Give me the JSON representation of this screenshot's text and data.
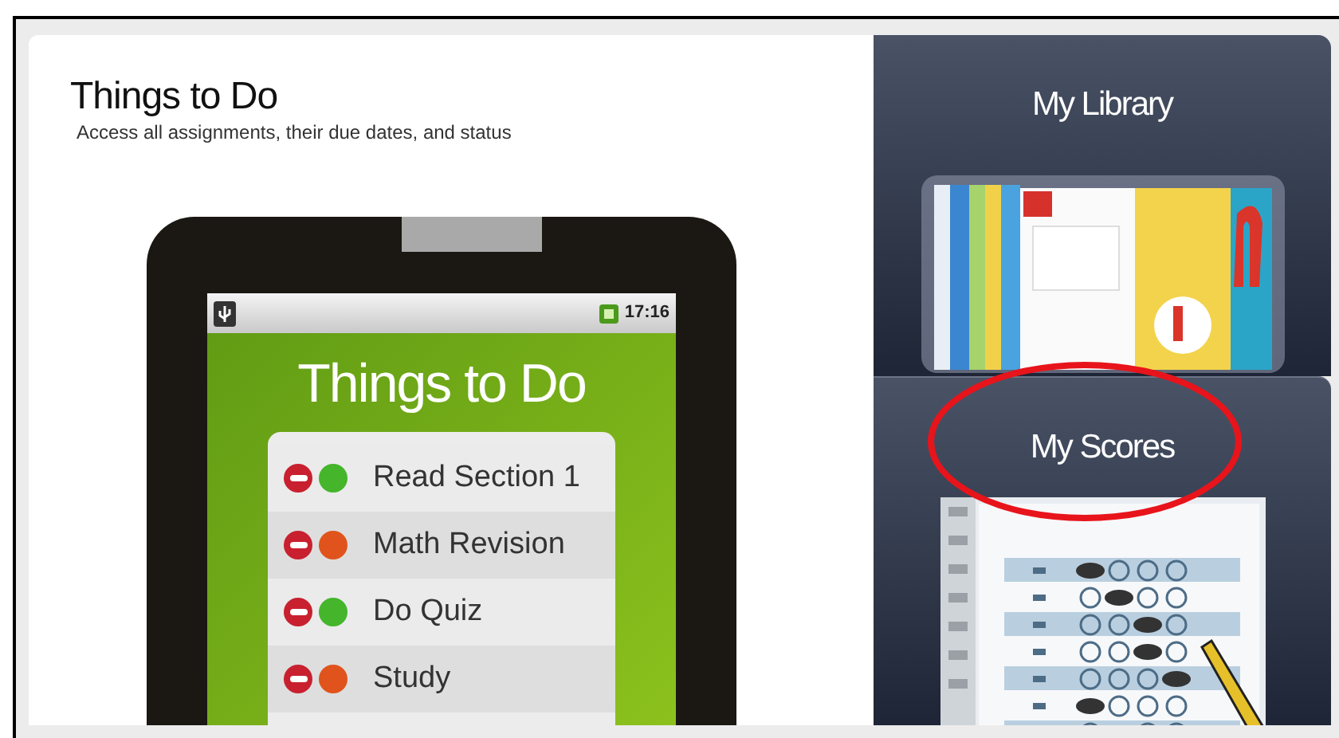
{
  "main": {
    "title": "Things to Do",
    "subtitle": "Access all assignments, their due dates, and status"
  },
  "device": {
    "clock": "17:16",
    "app_title": "Things to Do",
    "tasks": [
      {
        "label": "Read Section 1",
        "color": "#45b52b"
      },
      {
        "label": "Math Revision",
        "color": "#e0531c"
      },
      {
        "label": "Do Quiz",
        "color": "#45b52b"
      },
      {
        "label": "Study",
        "color": "#e0531c"
      }
    ]
  },
  "tiles": [
    {
      "title": "My Library",
      "kind": "library",
      "highlighted": false
    },
    {
      "title": "My Scores",
      "kind": "scores",
      "highlighted": true
    }
  ]
}
